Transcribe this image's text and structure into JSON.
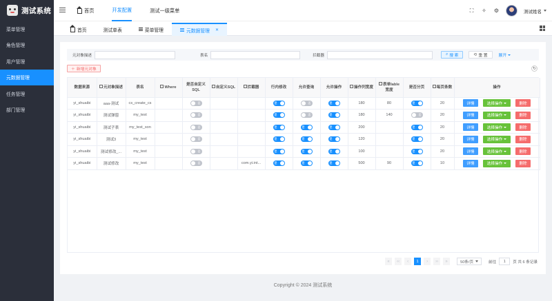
{
  "app": {
    "title": "测试系统"
  },
  "sidebar": {
    "items": [
      {
        "label": "菜单管理"
      },
      {
        "label": "角色管理"
      },
      {
        "label": "用户管理"
      },
      {
        "label": "元数据管理"
      },
      {
        "label": "任务管理"
      },
      {
        "label": "部门管理"
      }
    ]
  },
  "topnav": {
    "items": [
      {
        "label": "首页"
      },
      {
        "label": "开发配置"
      },
      {
        "label": "测试一级菜单"
      }
    ]
  },
  "header": {
    "user_name": "测试姓名"
  },
  "tabs": [
    {
      "label": "首页"
    },
    {
      "label": "测试单表"
    },
    {
      "label": "菜单管理"
    },
    {
      "label": "元数据管理"
    }
  ],
  "search": {
    "field1_label": "元对象描述",
    "field2_label": "表名",
    "field3_label": "拦截器",
    "search_label": "搜 索",
    "reset_label": "重 置",
    "expand_label": "展开"
  },
  "add_button": "新增元对象",
  "table": {
    "headers": [
      "数据来源",
      "元对象描述",
      "表名",
      "Where",
      "是否自定义SQL",
      "自定义SQL",
      "拦截器",
      "行内修改",
      "允许查询",
      "允许操作",
      "操作列宽度",
      "表单lable宽度",
      "是否分页",
      "每页条数",
      "操作"
    ],
    "switch_on_text": "是",
    "switch_off_text": "否",
    "op_detail": "详情",
    "op_select": "选择操作",
    "op_delete": "删除",
    "rows": [
      {
        "source": "yi_shuaibi",
        "desc": "aaa-测试",
        "table": "cs_create_cs",
        "where": "",
        "is_custom_sql": false,
        "custom_sql": "",
        "interceptor": "",
        "inline_edit": true,
        "allow_query": false,
        "allow_op": true,
        "op_width": "180",
        "label_width": "80",
        "paged": true,
        "page_size": "20"
      },
      {
        "source": "yi_shuaibi",
        "desc": "测试弹窗",
        "table": "my_test",
        "where": "",
        "is_custom_sql": false,
        "custom_sql": "",
        "interceptor": "",
        "inline_edit": true,
        "allow_query": false,
        "allow_op": true,
        "op_width": "180",
        "label_width": "140",
        "paged": false,
        "page_size": "20"
      },
      {
        "source": "yi_shuaibi",
        "desc": "测试子表",
        "table": "my_test_son",
        "where": "",
        "is_custom_sql": false,
        "custom_sql": "",
        "interceptor": "",
        "inline_edit": true,
        "allow_query": true,
        "allow_op": true,
        "op_width": "200",
        "label_width": "",
        "paged": true,
        "page_size": "20"
      },
      {
        "source": "yi_shuaibi",
        "desc": "测试3",
        "table": "my_test",
        "where": "",
        "is_custom_sql": false,
        "custom_sql": "",
        "interceptor": "",
        "inline_edit": true,
        "allow_query": true,
        "allow_op": true,
        "op_width": "120",
        "label_width": "",
        "paged": true,
        "page_size": "20"
      },
      {
        "source": "yi_shuaibi",
        "desc": "测试修改_...",
        "table": "my_test",
        "where": "",
        "is_custom_sql": false,
        "custom_sql": "",
        "interceptor": "",
        "inline_edit": true,
        "allow_query": true,
        "allow_op": true,
        "op_width": "100",
        "label_width": "",
        "paged": true,
        "page_size": "20"
      },
      {
        "source": "yi_shuaibi",
        "desc": "测试修改",
        "table": "my_test",
        "where": "",
        "is_custom_sql": false,
        "custom_sql": "",
        "interceptor": "com.yi.int...",
        "inline_edit": true,
        "allow_query": true,
        "allow_op": true,
        "op_width": "500",
        "label_width": "90",
        "paged": true,
        "page_size": "10"
      }
    ]
  },
  "pager": {
    "current_page": "1",
    "page_size_label": "50条/页",
    "goto_label": "前往",
    "goto_value": "1",
    "total_label": "页 共 6 条记录"
  },
  "footer": "Copyright © 2024 测试系统"
}
